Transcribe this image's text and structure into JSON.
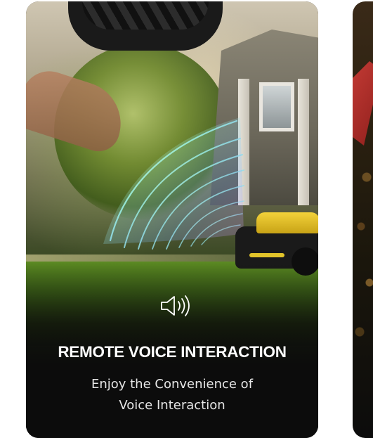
{
  "feature_card": {
    "title": "REMOTE VOICE INTERACTION",
    "subtitle_line1": "Enjoy the Convenience of",
    "subtitle_line2": "Voice Interaction",
    "icon": "speaker-sound-icon",
    "colors": {
      "card_background": "#0c0c0c",
      "title_color": "#ffffff",
      "subtitle_color": "#e6e6e6",
      "mower_accent": "#f2d23a"
    }
  },
  "next_card": {
    "icon": "partial-image"
  }
}
